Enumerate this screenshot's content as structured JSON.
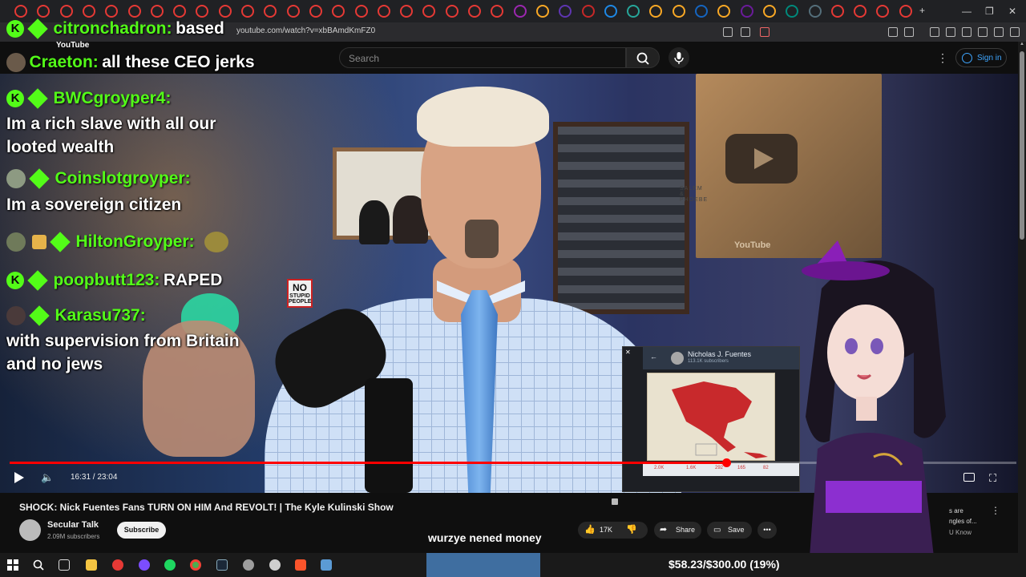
{
  "browser": {
    "url": "youtube.com/watch?v=xbBAmdKmFZ0",
    "tab_colors": [
      "#e53935",
      "#e53935",
      "#e53935",
      "#e53935",
      "#e53935",
      "#e53935",
      "#e53935",
      "#e53935",
      "#e53935",
      "#e53935",
      "#e53935",
      "#e53935",
      "#e53935",
      "#e53935",
      "#e53935",
      "#e53935",
      "#e53935",
      "#e53935",
      "#e53935",
      "#e53935",
      "#e53935",
      "#e53935",
      "#9c27b0",
      "#f9a825",
      "#5e35b1",
      "#c62828",
      "#1e88e5",
      "#26a69a",
      "#f9a825",
      "#f9a825",
      "#1565c0",
      "#f9a825",
      "#6a1b9a",
      "#f9a825",
      "#00897b",
      "#546e7a",
      "#e53935",
      "#e53935",
      "#e53935",
      "#e53935"
    ],
    "new_tab_glyph": "+",
    "window_controls": [
      "—",
      "❐",
      "✕"
    ]
  },
  "youtube": {
    "search_placeholder": "Search",
    "sign_in_label": "Sign in",
    "logo_text": "YouTube"
  },
  "chat": [
    {
      "user": "citronchadron:",
      "message": "based",
      "badges": [
        "kick",
        "sub"
      ]
    },
    {
      "user": "Craeton:",
      "message": "all these CEO jerks",
      "badges": [
        "avatar"
      ]
    },
    {
      "user": "BWCgroyper4:",
      "message": "Im a rich slave with all our\nlooted wealth",
      "badges": [
        "kick",
        "sub"
      ]
    },
    {
      "user": "Coinslotgroyper:",
      "message": "Im a sovereign citizen",
      "badges": [
        "avatar",
        "sub"
      ]
    },
    {
      "user": "HiltonGroyper:",
      "message": "",
      "badges": [
        "avatar",
        "gift",
        "sub"
      ]
    },
    {
      "user": "poopbutt123:",
      "message": "RAPED",
      "badges": [
        "kick",
        "sub"
      ]
    },
    {
      "user": "Karasu737:",
      "message": "with supervision from Britain\nand no jews",
      "badges": [
        "avatar",
        "sub"
      ]
    }
  ],
  "video_scene": {
    "frame_text": "SALEM & PHOEBE",
    "sign_small": "NO",
    "sign_text": "STUPID PEOPLE",
    "plaque_logo": "YouTube"
  },
  "player": {
    "progress_fraction": 0.712,
    "time_display": "16:31 / 23:04"
  },
  "phone_overlay": {
    "channel_name": "Nicholas J. Fuentes",
    "subscribers": "113.1K subscribers",
    "reactions": [
      "2.0K",
      "1.6K",
      "292",
      "165",
      "82"
    ]
  },
  "video_info": {
    "title": "SHOCK: Nick Fuentes Fans TURN ON HIM And REVOLT! | The Kyle Kulinski Show",
    "channel": "Secular Talk",
    "subscribers": "2.09M subscribers",
    "subscribe_label": "Subscribe",
    "likes": "17K",
    "share_label": "Share",
    "save_label": "Save",
    "sidebar_snippets": [
      "s are",
      "ngles of...",
      "U Know"
    ]
  },
  "caption": "wurzye nened money",
  "donation": {
    "text": "$58.23/$300.00 (19%)",
    "fraction": 0.19
  }
}
